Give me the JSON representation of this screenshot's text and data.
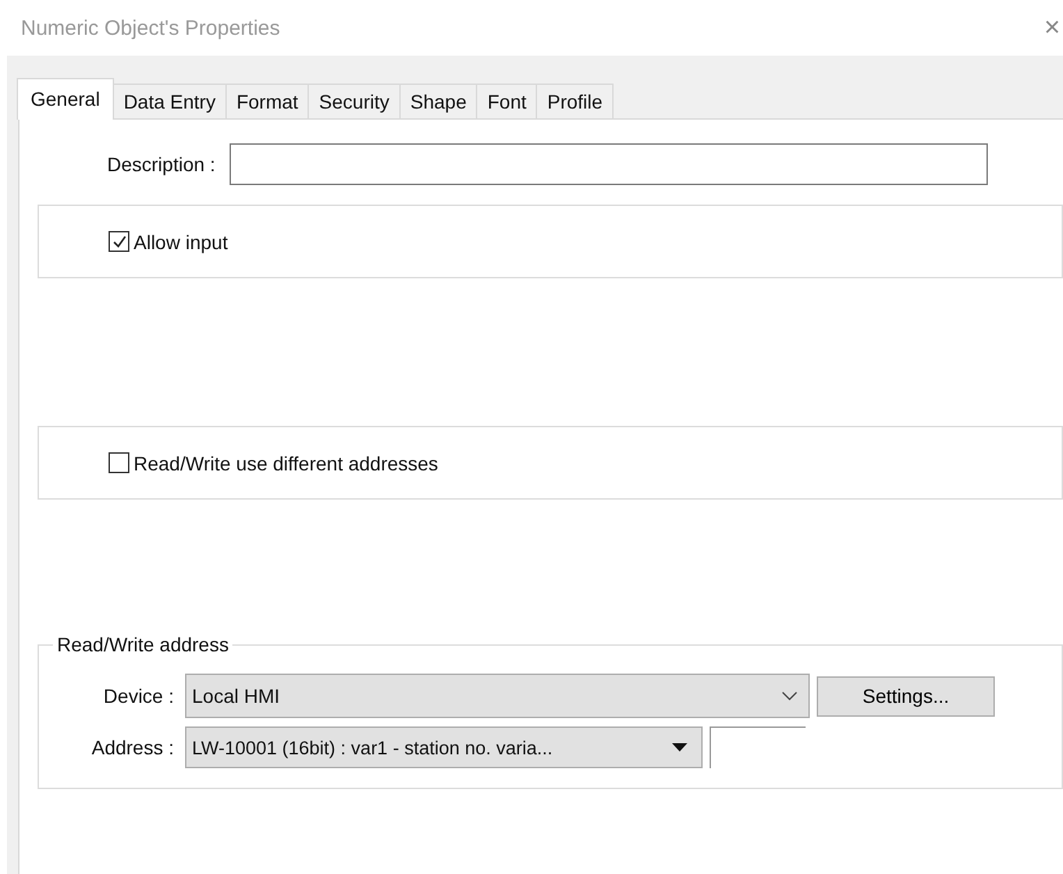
{
  "window": {
    "title": "Numeric Object's Properties",
    "close": "×"
  },
  "tabs": [
    {
      "label": "General",
      "selected": true
    },
    {
      "label": "Data Entry",
      "selected": false
    },
    {
      "label": "Format",
      "selected": false
    },
    {
      "label": "Security",
      "selected": false
    },
    {
      "label": "Shape",
      "selected": false
    },
    {
      "label": "Font",
      "selected": false
    },
    {
      "label": "Profile",
      "selected": false
    }
  ],
  "description": {
    "label": "Description :"
  },
  "allow_input": {
    "label": "Allow input",
    "checked": true
  },
  "different_addresses": {
    "label": "Read/Write use different addresses",
    "checked": false
  },
  "rw_address": {
    "legend": "Read/Write address",
    "device": {
      "label": "Device :",
      "value": "Local HMI"
    },
    "settings_button": "Settings...",
    "address": {
      "label": "Address :",
      "value": "LW-10001 (16bit) : var1 - station no. varia..."
    }
  }
}
